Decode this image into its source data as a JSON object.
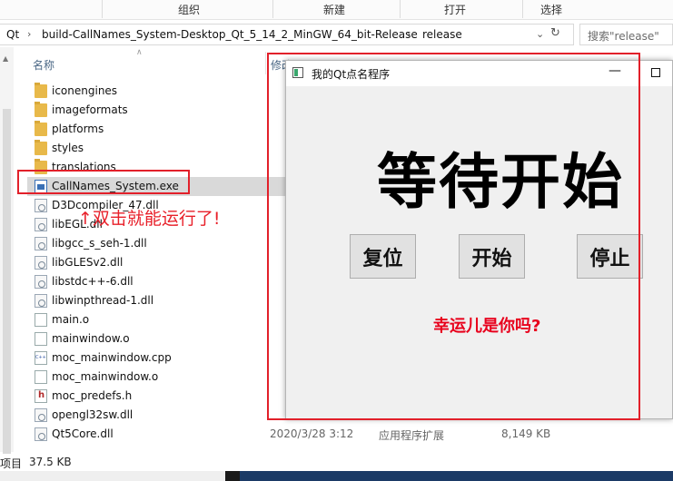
{
  "ribbon": {
    "groups": [
      "组织",
      "新建",
      "打开",
      "选择"
    ]
  },
  "address": {
    "crumbs": [
      "Qt",
      "build-CallNames_System-Desktop_Qt_5_14_2_MinGW_64_bit-Release",
      "release"
    ],
    "search_placeholder": "搜索\"release\""
  },
  "columns": {
    "name": "名称",
    "modified": "修改"
  },
  "files": [
    {
      "name": "iconengines",
      "icon": "folder-icon",
      "date": "",
      "type": "",
      "size": ""
    },
    {
      "name": "imageformats",
      "icon": "folder-icon",
      "date": "",
      "type": "",
      "size": ""
    },
    {
      "name": "platforms",
      "icon": "folder-icon",
      "date": "",
      "type": "",
      "size": ""
    },
    {
      "name": "styles",
      "icon": "folder-icon",
      "date": "",
      "type": "",
      "size": ""
    },
    {
      "name": "translations",
      "icon": "folder-icon",
      "date": "",
      "type": "",
      "size": ""
    },
    {
      "name": "CallNames_System.exe",
      "icon": "exe-icon",
      "date": "",
      "type": "",
      "size": ""
    },
    {
      "name": "D3Dcompiler_47.dll",
      "icon": "dll-icon",
      "date": "",
      "type": "",
      "size": ""
    },
    {
      "name": "libEGL.dll",
      "icon": "dll-icon",
      "date": "",
      "type": "",
      "size": ""
    },
    {
      "name": "libgcc_s_seh-1.dll",
      "icon": "dll-icon",
      "date": "",
      "type": "",
      "size": ""
    },
    {
      "name": "libGLESv2.dll",
      "icon": "dll-icon",
      "date": "",
      "type": "",
      "size": ""
    },
    {
      "name": "libstdc++-6.dll",
      "icon": "dll-icon",
      "date": "",
      "type": "",
      "size": ""
    },
    {
      "name": "libwinpthread-1.dll",
      "icon": "dll-icon",
      "date": "",
      "type": "",
      "size": ""
    },
    {
      "name": "main.o",
      "icon": "file-icon",
      "date": "",
      "type": "",
      "size": ""
    },
    {
      "name": "mainwindow.o",
      "icon": "file-icon",
      "date": "",
      "type": "",
      "size": ""
    },
    {
      "name": "moc_mainwindow.cpp",
      "icon": "cpp-file-icon",
      "date": "",
      "type": "",
      "size": ""
    },
    {
      "name": "moc_mainwindow.o",
      "icon": "file-icon",
      "date": "",
      "type": "",
      "size": ""
    },
    {
      "name": "moc_predefs.h",
      "icon": "header-file-icon",
      "date": "",
      "type": "",
      "size": ""
    },
    {
      "name": "opengl32sw.dll",
      "icon": "dll-icon",
      "date": "",
      "type": "",
      "size": ""
    },
    {
      "name": "Qt5Core.dll",
      "icon": "dll-icon",
      "date": "2020/3/28 3:12",
      "type": "应用程序扩展",
      "size": "8,149 KB"
    }
  ],
  "status": {
    "items_label": "项目",
    "size": "37.5 KB"
  },
  "qt_window": {
    "title": "我的Qt点名程序",
    "main_text": "等待开始",
    "buttons": [
      "复位",
      "开始",
      "停止"
    ],
    "lucky_text": "幸运儿是你吗?"
  },
  "annotation": {
    "text": "↑双击就能运行了!"
  },
  "colors": {
    "annotation": "#e2202a",
    "lucky": "#e8001c",
    "selection": "#d9d9d9"
  }
}
